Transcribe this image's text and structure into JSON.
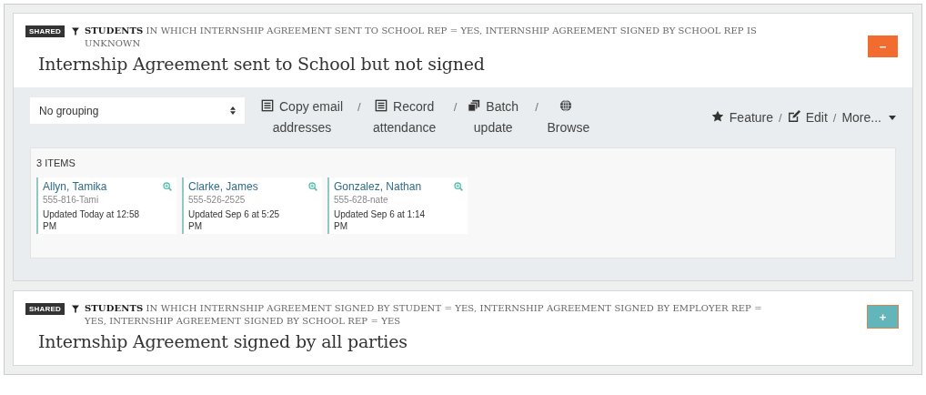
{
  "panels": [
    {
      "badge": "SHARED",
      "filter": "**STUDENTS** IN WHICH INTERNSHIP AGREEMENT SENT TO SCHOOL REP = YES, INTERNSHIP AGREEMENT SIGNED BY SCHOOL REP IS UNKNOWN",
      "title": "Internship Agreement sent to School but not signed",
      "expanded": true,
      "toggle": "−",
      "toolbar": {
        "grouping": "No grouping",
        "actions": [
          {
            "kind": "list",
            "label": "Copy email addresses"
          },
          {
            "separator": "/",
            "kind": "list",
            "label": "Record attendance"
          },
          {
            "separator": "/",
            "kind": "stack",
            "label": "Batch update"
          },
          {
            "separator": "/",
            "kind": "globe",
            "label": "Browse"
          }
        ],
        "right_actions": [
          {
            "kind": "star",
            "label": "Feature"
          },
          {
            "separator": "/",
            "kind": "edit",
            "label": "Edit"
          },
          {
            "separator": "/",
            "label": "More...",
            "dropdown": true
          }
        ]
      },
      "list": {
        "count": "3 ITEMS",
        "items": [
          {
            "name": "Allyn, Tamika",
            "phone": "555-816-Tami",
            "updated": "Updated Today at 12:58 PM"
          },
          {
            "name": "Clarke, James",
            "phone": "555-526-2525",
            "updated": "Updated Sep 6 at 5:25 PM"
          },
          {
            "name": "Gonzalez, Nathan",
            "phone": "555-628-nate",
            "updated": "Updated Sep 6 at 1:14 PM"
          }
        ]
      }
    },
    {
      "badge": "SHARED",
      "filter": "**STUDENTS** IN WHICH INTERNSHIP AGREEMENT SIGNED BY STUDENT = YES, INTERNSHIP AGREEMENT SIGNED BY EMPLOYER REP = YES, INTERNSHIP AGREEMENT SIGNED BY SCHOOL REP = YES",
      "title": "Internship Agreement signed by all parties",
      "expanded": false,
      "toggle": "+"
    }
  ]
}
